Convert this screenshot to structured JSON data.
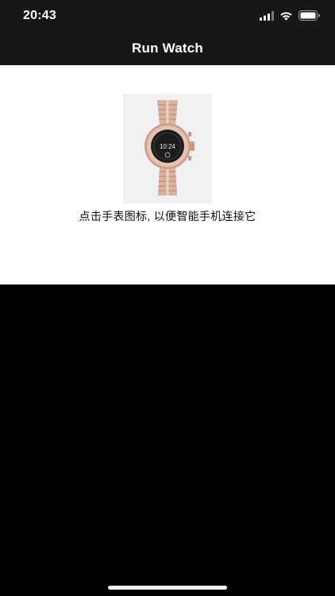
{
  "status_bar": {
    "time": "20:43",
    "icons": [
      "cellular-signal-icon",
      "wifi-icon",
      "battery-icon"
    ]
  },
  "nav": {
    "title": "Run Watch"
  },
  "main": {
    "watch_image": {
      "face_time": "10:24",
      "icon": "smartwatch-image"
    },
    "hint": "点击手表图标, 以便智能手机连接它"
  },
  "colors": {
    "bar_background": "#171717",
    "content_background": "#ffffff",
    "screen_background": "#000000",
    "watch_rose_gold": "#d8a996"
  }
}
